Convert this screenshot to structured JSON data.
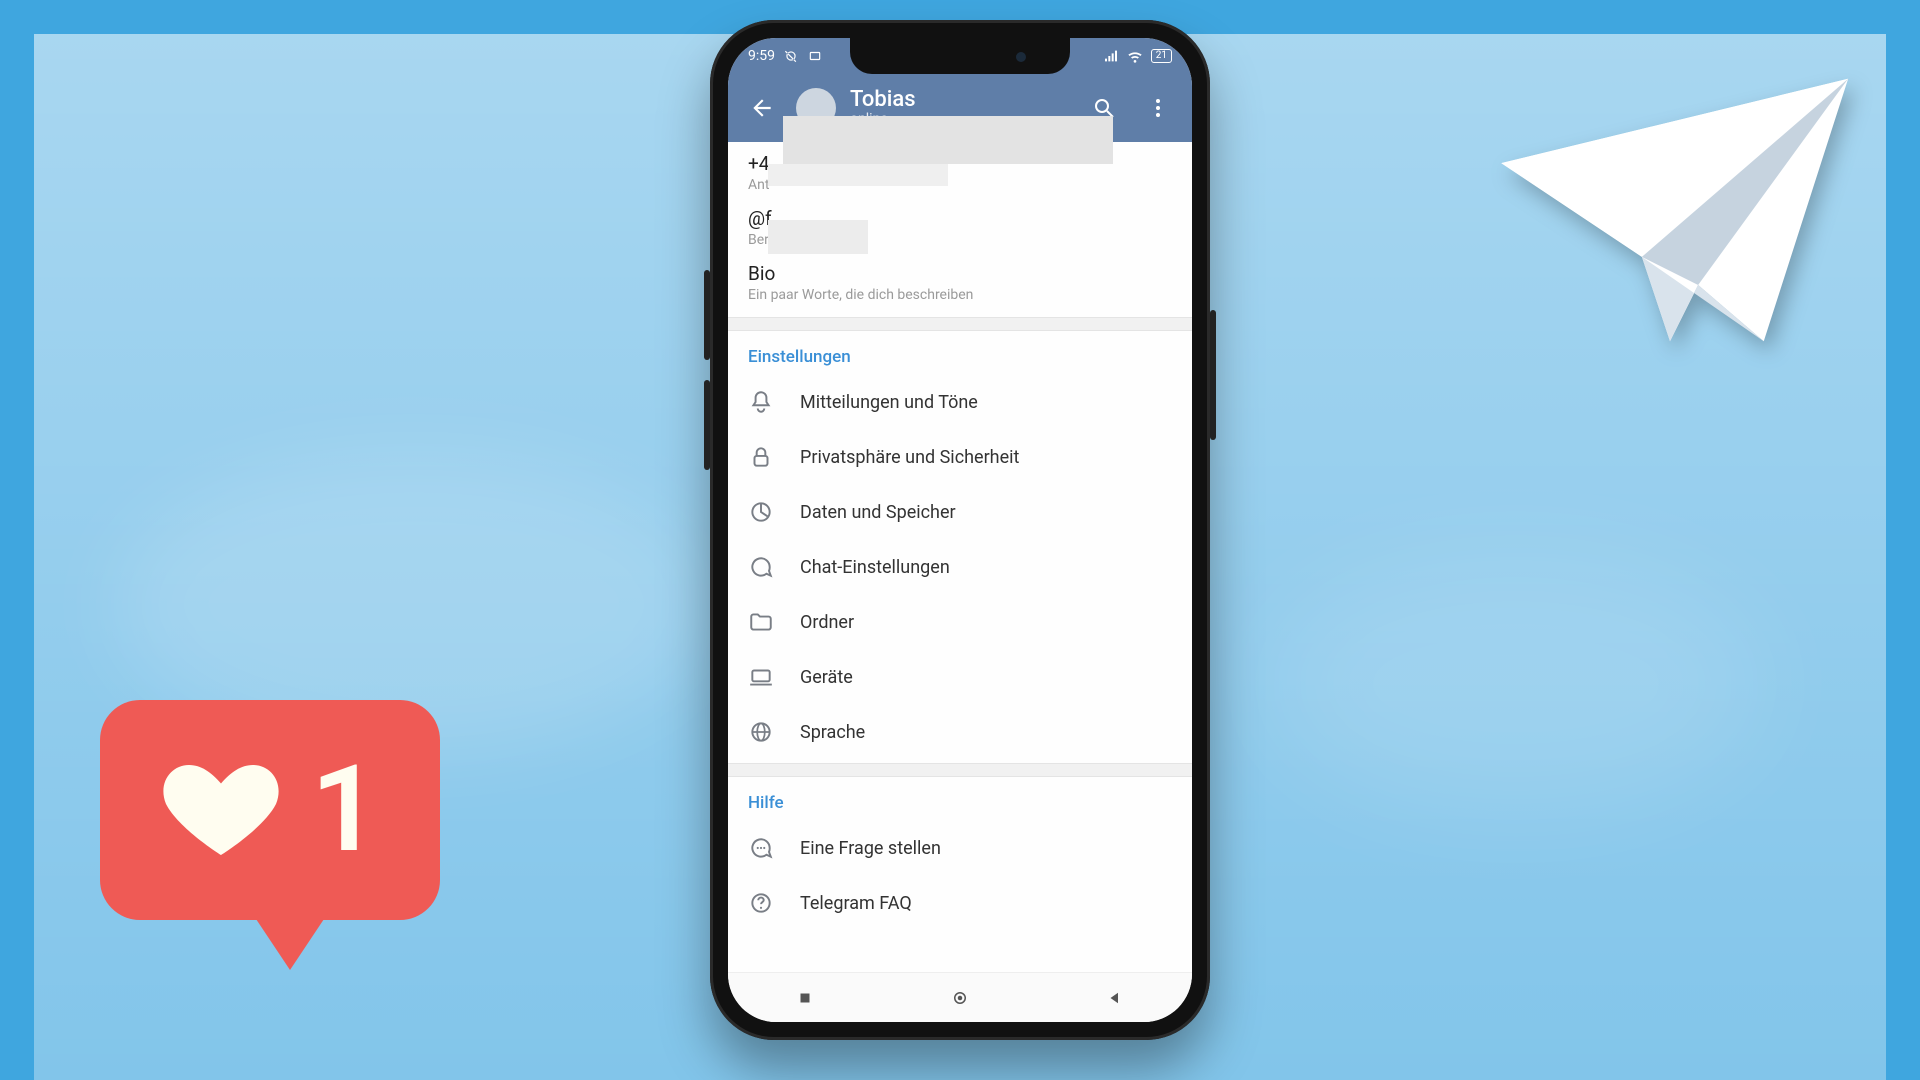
{
  "statusbar": {
    "time": "9:59",
    "battery": "21"
  },
  "appbar": {
    "title": "Tobias",
    "subtitle": "online"
  },
  "profile": {
    "phone_value": "+4",
    "phone_label": "Ant",
    "username_value": "@f",
    "username_label": "Ber",
    "bio_value": "Bio",
    "bio_label": "Ein paar Worte, die dich beschreiben"
  },
  "sections": {
    "settings_header": "Einstellungen",
    "items": [
      {
        "label": "Mitteilungen und Töne"
      },
      {
        "label": "Privatsphäre und Sicherheit"
      },
      {
        "label": "Daten und Speicher"
      },
      {
        "label": "Chat-Einstellungen"
      },
      {
        "label": "Ordner"
      },
      {
        "label": "Geräte"
      },
      {
        "label": "Sprache"
      }
    ],
    "help_header": "Hilfe",
    "help_items": [
      {
        "label": "Eine Frage stellen"
      },
      {
        "label": "Telegram FAQ"
      }
    ]
  },
  "like": {
    "count": "1"
  }
}
